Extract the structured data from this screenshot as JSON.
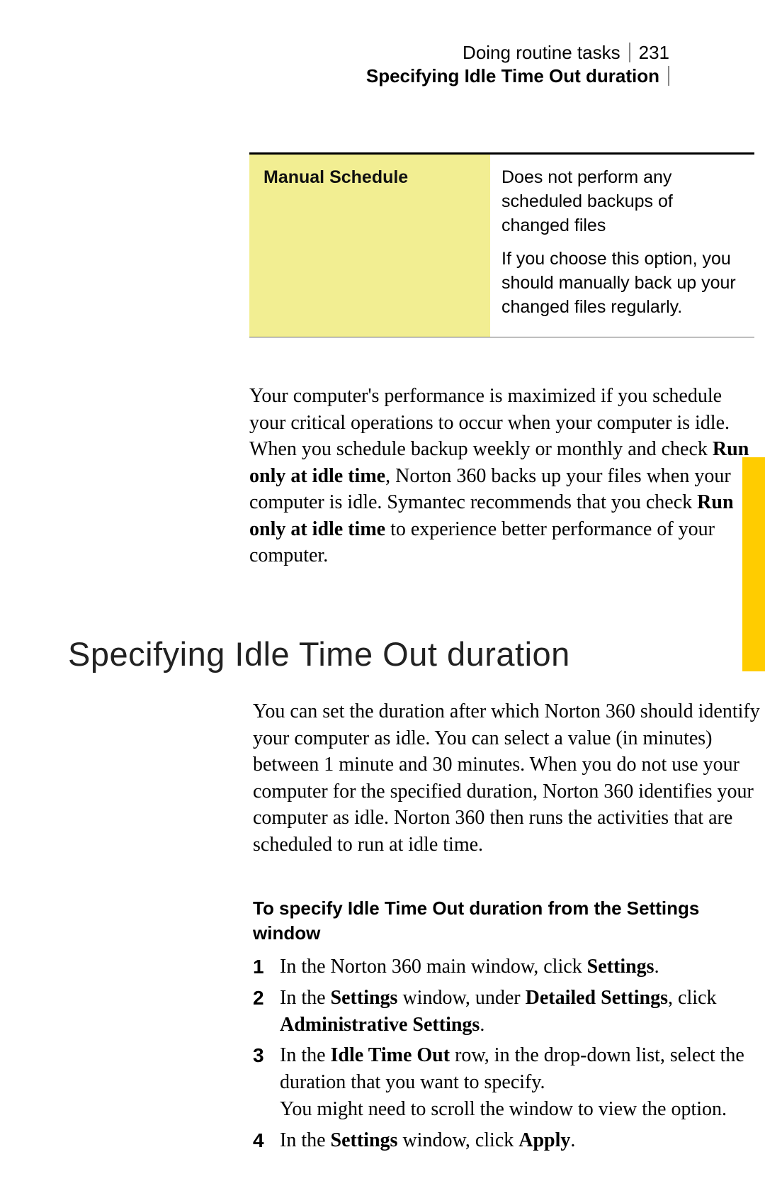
{
  "header": {
    "chapter": "Doing routine tasks",
    "page_number": "231",
    "section": "Specifying Idle Time Out duration"
  },
  "table": {
    "label": "Manual Schedule",
    "desc1": "Does not perform any scheduled backups of changed files",
    "desc2": "If you choose this option, you should manually back up your changed files regularly."
  },
  "para1": {
    "t1": "Your computer's performance is maximized if you schedule your critical operations to occur when your computer is idle. When you schedule backup weekly or monthly and check ",
    "b1": "Run only at idle time",
    "t2": ", Norton 360 backs up your files when your computer is idle. Symantec recommends that you check ",
    "b2": "Run only at idle time",
    "t3": " to experience better performance of your computer."
  },
  "h1": "Specifying Idle Time Out duration",
  "para2": "You can set the duration after which Norton 360 should identify your computer as idle. You can select a value (in minutes) between 1 minute and 30 minutes. When you do not use your computer for the specified duration, Norton 360 identifies your computer as idle. Norton 360 then runs the activities that are scheduled to run at idle time.",
  "subhead": "To specify Idle Time Out duration from the Settings window",
  "steps": [
    {
      "n": "1",
      "t1": "In the Norton 360 main window, click ",
      "b1": "Settings",
      "t2": "."
    },
    {
      "n": "2",
      "t1": "In the ",
      "b1": "Settings",
      "t2": " window, under ",
      "b2": "Detailed Settings",
      "t3": ", click ",
      "b3": "Administrative Settings",
      "t4": "."
    },
    {
      "n": "3",
      "t1": "In the ",
      "b1": "Idle Time Out",
      "t2": " row, in the drop-down list, select the duration that you want to specify.",
      "br": true,
      "t3": "You might need to scroll the window to view the option."
    },
    {
      "n": "4",
      "t1": "In the ",
      "b1": "Settings",
      "t2": " window, click ",
      "b2": "Apply",
      "t3": "."
    }
  ]
}
